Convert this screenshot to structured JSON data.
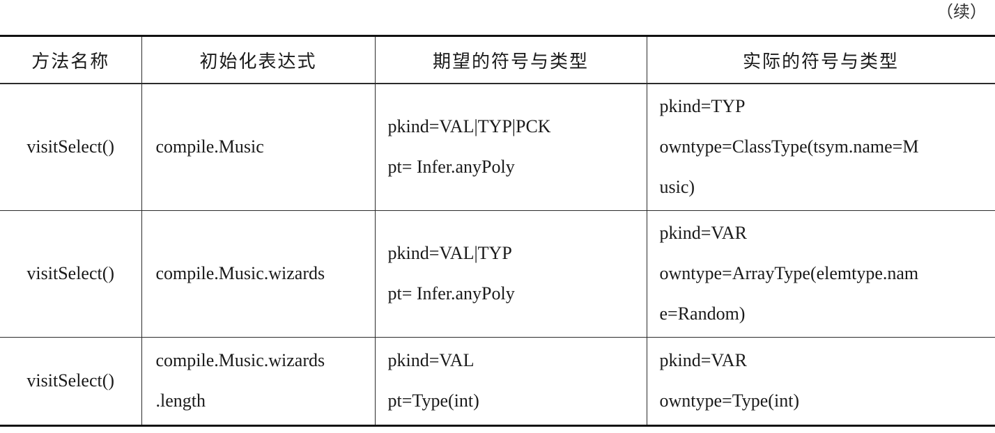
{
  "continued_marker": "（续）",
  "table": {
    "headers": [
      "方法名称",
      "初始化表达式",
      "期望的符号与类型",
      "实际的符号与类型"
    ],
    "rows": [
      {
        "method": "visitSelect()",
        "expression": [
          "compile.Music"
        ],
        "expected": [
          "pkind=VAL|TYP|PCK",
          "pt= Infer.anyPoly"
        ],
        "actual": [
          "pkind=TYP",
          "owntype=ClassType(tsym.name=M",
          "usic)"
        ]
      },
      {
        "method": "visitSelect()",
        "expression": [
          "compile.Music.wizards"
        ],
        "expected": [
          "pkind=VAL|TYP",
          "pt= Infer.anyPoly"
        ],
        "actual": [
          "pkind=VAR",
          "owntype=ArrayType(elemtype.nam",
          "e=Random)"
        ]
      },
      {
        "method": "visitSelect()",
        "expression": [
          "compile.Music.wizards",
          ".length"
        ],
        "expected": [
          "pkind=VAL",
          "pt=Type(int)"
        ],
        "actual": [
          "pkind=VAR",
          "owntype=Type(int)"
        ]
      }
    ]
  }
}
